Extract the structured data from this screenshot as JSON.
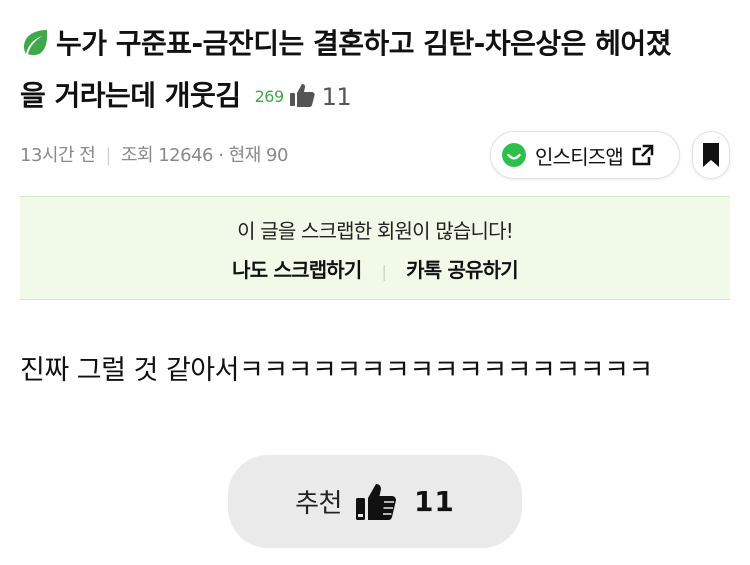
{
  "post": {
    "title_line1": "누가 구준표-금잔디는 결혼하고 김탄-차은상은 헤어졌",
    "title_line2": "을 거라는데 개웃김",
    "comment_count": "269",
    "like_count": "11",
    "time_ago": "13시간 전",
    "views": "조회 12646 · 현재 90",
    "body": "진짜 그럴 것 같아서ㅋㅋㅋㅋㅋㅋㅋㅋㅋㅋㅋㅋㅋㅋㅋㅋㅋ"
  },
  "community": {
    "name": "인스티즈앱"
  },
  "scrap_banner": {
    "message": "이 글을 스크랩한 회원이 많습니다!",
    "scrap_label": "나도 스크랩하기",
    "share_label": "카톡 공유하기"
  },
  "recommend": {
    "label": "추천",
    "count": "11"
  },
  "colors": {
    "accent_green": "#3ea84a",
    "banner_bg": "#f1fae9",
    "button_bg": "#eaeaea"
  },
  "icons": {
    "title": "leaf-icon",
    "like": "thumbs-up-icon",
    "community": "smile-icon",
    "external": "external-link-icon",
    "bookmark": "bookmark-icon"
  }
}
